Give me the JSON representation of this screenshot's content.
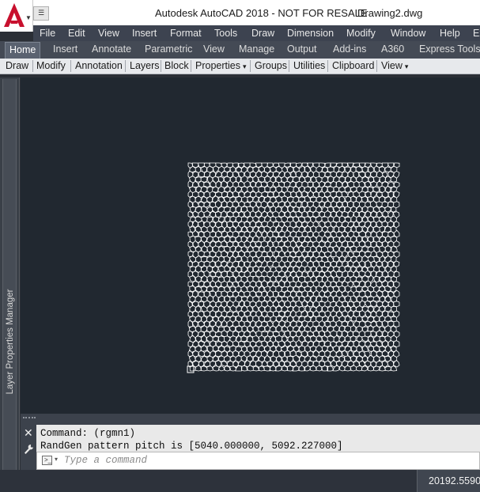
{
  "app": {
    "title": "Autodesk AutoCAD 2018 - NOT FOR RESALE",
    "file": "Drawing2.dwg",
    "logo_icon": "autocad-a-logo-icon",
    "brand_color": "#c8102e"
  },
  "menubar": [
    "File",
    "Edit",
    "View",
    "Insert",
    "Format",
    "Tools",
    "Draw",
    "Dimension",
    "Modify",
    "Window",
    "Help",
    "Ex"
  ],
  "ribbon_tabs": [
    "Home",
    "Insert",
    "Annotate",
    "Parametric",
    "View",
    "Manage",
    "Output",
    "Add-ins",
    "A360",
    "Express Tools"
  ],
  "active_tab": "Home",
  "ribbon_panels": [
    "Draw",
    "Modify",
    "Annotation",
    "Layers",
    "Block",
    "Properties",
    "Groups",
    "Utilities",
    "Clipboard",
    "View"
  ],
  "side_palette": {
    "label": "Layer Properties Manager"
  },
  "command": {
    "history": [
      "Command: (rgmn1)",
      "RandGen pattern pitch is [5040.000000, 5092.227000]"
    ],
    "placeholder": "Type a command"
  },
  "status": {
    "coords": "20192.5590,"
  },
  "colors": {
    "canvas": "#212830",
    "pattern_stroke": "#ffffff"
  }
}
